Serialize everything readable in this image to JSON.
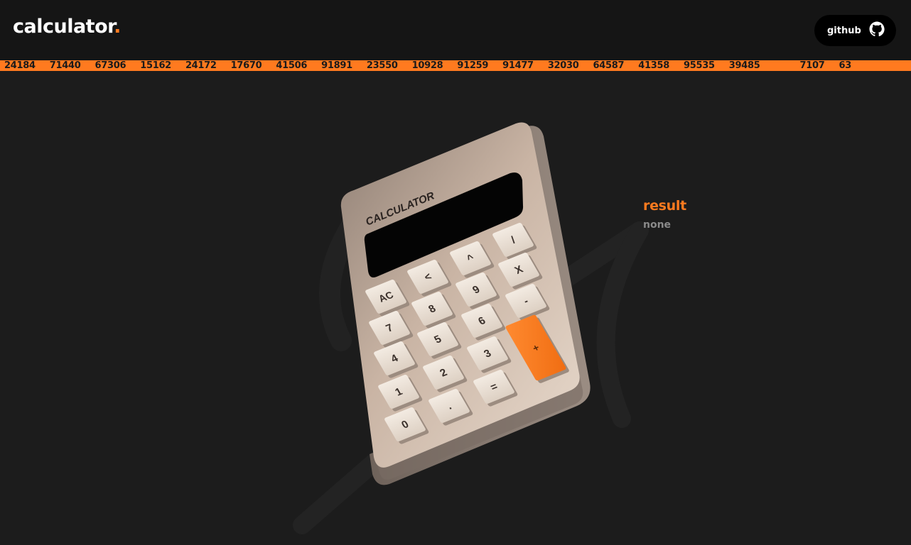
{
  "header": {
    "logo": "calculator",
    "logo_dot": ".",
    "github_label": "github"
  },
  "ticker": [
    "24184",
    "71440",
    "67306",
    "15162",
    "24172",
    "17670",
    "41506",
    "91891",
    "23550",
    "10928",
    "91259",
    "91477",
    "32030",
    "64587",
    "41358",
    "95535",
    "39485",
    "",
    "7107",
    "63"
  ],
  "calculator": {
    "brand": "CALCULATOR",
    "display": "",
    "keys": {
      "divide": "/",
      "power": "^",
      "back": "<",
      "clear": "AC",
      "multiply": "X",
      "nine": "9",
      "eight": "8",
      "seven": "7",
      "minus": "-",
      "six": "6",
      "five": "5",
      "four": "4",
      "plus": "+",
      "three": "3",
      "two": "2",
      "one": "1",
      "equals": "=",
      "dot": ".",
      "zero": "0"
    }
  },
  "result": {
    "title": "result",
    "value": "none"
  },
  "colors": {
    "accent": "#ff7a1f",
    "background": "#1c1c1c",
    "header": "#151515",
    "calculator_body": "#d9c6b6",
    "key": "#efe6dc"
  }
}
